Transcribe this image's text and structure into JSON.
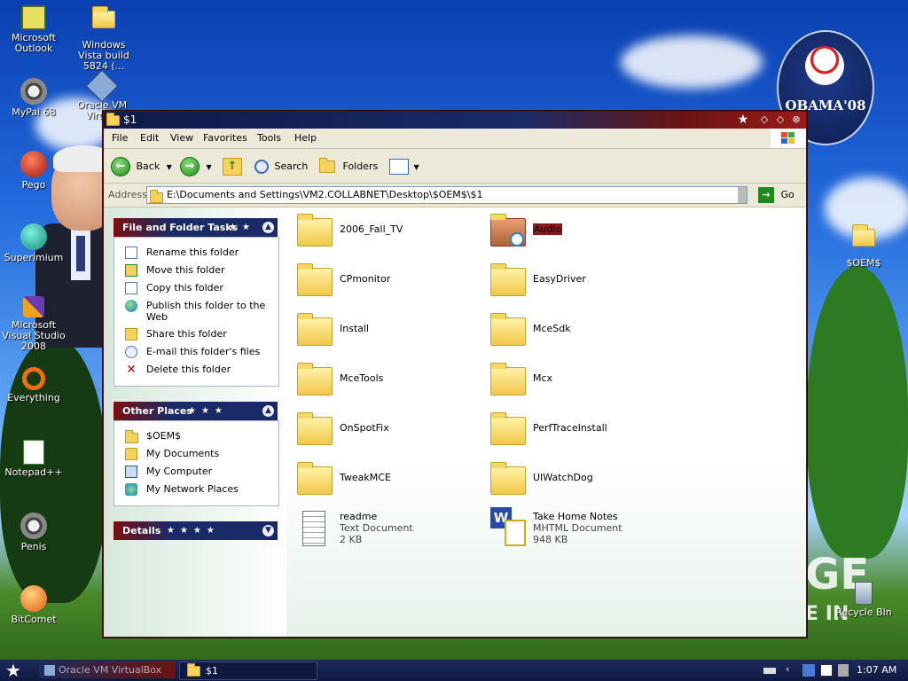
{
  "desktop": {
    "icons": [
      {
        "label": "Microsoft Outlook"
      },
      {
        "label": "Windows Vista build 5824 (..."
      },
      {
        "label": "MyPal 68"
      },
      {
        "label": "Oracle VM Virtu..."
      },
      {
        "label": "Pego"
      },
      {
        "label": "Superimium"
      },
      {
        "label": "Microsoft Visual Studio 2008"
      },
      {
        "label": "Everything"
      },
      {
        "label": "Notepad++"
      },
      {
        "label": "Penis"
      },
      {
        "label": "BitComet"
      },
      {
        "label": "$OEM$"
      },
      {
        "label": "Recycle Bin"
      }
    ],
    "wallpaper_badge": "OBAMA'08",
    "wallpaper_text_1": "GE",
    "wallpaper_text_2": "E IN"
  },
  "window": {
    "title": "$1",
    "menu": [
      "File",
      "Edit",
      "View",
      "Favorites",
      "Tools",
      "Help"
    ],
    "toolbar": {
      "back": "Back",
      "search": "Search",
      "folders": "Folders"
    },
    "address": {
      "label": "Address",
      "path": "E:\\Documents and Settings\\VM2.COLLABNET\\Desktop\\$OEM$\\$1",
      "go": "Go"
    },
    "taskpane": {
      "file_tasks": {
        "title": "File and Folder Tasks",
        "items": [
          "Rename this folder",
          "Move this folder",
          "Copy this folder",
          "Publish this folder to the Web",
          "Share this folder",
          "E-mail this folder's files",
          "Delete this folder"
        ]
      },
      "other_places": {
        "title": "Other Places",
        "items": [
          "$OEM$",
          "My Documents",
          "My Computer",
          "My Network Places"
        ]
      },
      "details": {
        "title": "Details"
      }
    },
    "items": [
      {
        "name": "2006_Fall_TV",
        "type": "folder"
      },
      {
        "name": "Audio",
        "type": "folder",
        "selected": true
      },
      {
        "name": "CPmonitor",
        "type": "folder"
      },
      {
        "name": "EasyDriver",
        "type": "folder"
      },
      {
        "name": "Install",
        "type": "folder"
      },
      {
        "name": "MceSdk",
        "type": "folder"
      },
      {
        "name": "MceTools",
        "type": "folder"
      },
      {
        "name": "Mcx",
        "type": "folder"
      },
      {
        "name": "OnSpotFix",
        "type": "folder"
      },
      {
        "name": "PerfTraceInstall",
        "type": "folder"
      },
      {
        "name": "TweakMCE",
        "type": "folder"
      },
      {
        "name": "UIWatchDog",
        "type": "folder"
      },
      {
        "name": "readme",
        "type": "file",
        "kind": "Text Document",
        "size": "2 KB"
      },
      {
        "name": "Take Home Notes",
        "type": "file",
        "kind": "MHTML Document",
        "size": "948 KB"
      }
    ]
  },
  "taskbar": {
    "tasks": [
      {
        "label": "Oracle VM VirtualBox"
      },
      {
        "label": "$1"
      }
    ],
    "clock": "1:07 AM"
  },
  "colors": {
    "title_left": "#0e1a4a",
    "title_right": "#9a1a1a",
    "selection": "#8a1a1a",
    "taskbar": "#101a40"
  }
}
